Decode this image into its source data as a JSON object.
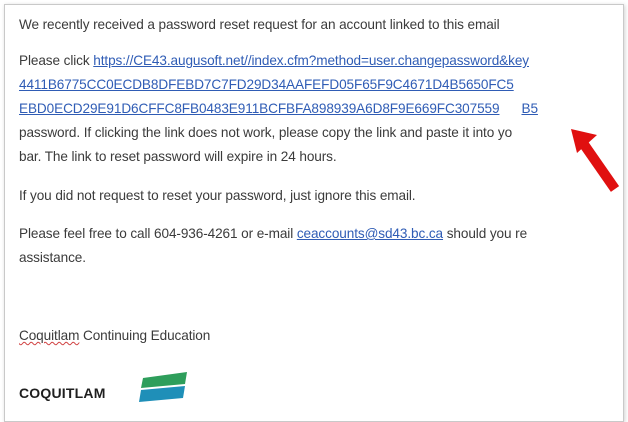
{
  "email": {
    "intro": "We recently received a password reset request for an account linked to this email",
    "click_prefix": "Please click ",
    "link_line_1": "https://CE43.augusoft.net//index.cfm?method=user.changepassword&key",
    "link_line_2": "4411B6775CC0ECDB8DFEBD7C7FD29D34AAFEFD05F65F9C4671D4B5650FC5",
    "link_line_3": "EBD0ECD29E91D6CFFC8FB0483E911BCFBFA898939A6D8F9E669FC307559",
    "link_line_3_tail": "B5",
    "line_password": "password. If clicking the link does not work, please copy the link and paste it into yo",
    "line_bar": "bar. The link to reset password will expire in 24 hours.",
    "ignore": "If you did not request to reset your password, just ignore this email.",
    "contact_prefix": "Please feel free to call 604-936-4261 or e-mail ",
    "contact_email": "ceaccounts@sd43.bc.ca",
    "contact_suffix": " should you re",
    "assistance": "assistance.",
    "signature_org_first": "Coquitlam",
    "signature_org_rest": " Continuing Education",
    "brand": "COQUITLAM"
  },
  "colors": {
    "link": "#2f5cb5",
    "text": "#3b3b3b",
    "arrow": "#e01010",
    "logo_green": "#2e9e5b",
    "logo_teal": "#1f8fb8"
  },
  "icons": {
    "arrow": "red-arrow-pointer-icon",
    "logo": "coquitlam-logo-icon"
  }
}
